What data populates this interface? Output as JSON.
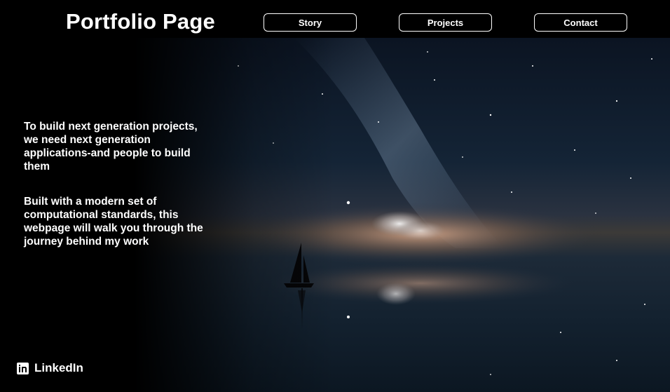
{
  "header": {
    "title": "Portfolio Page",
    "nav": [
      {
        "label": "Story"
      },
      {
        "label": "Projects"
      },
      {
        "label": "Contact"
      }
    ]
  },
  "hero": {
    "paragraphs": [
      "To build next generation projects, we need next generation applications-and people to build them",
      "Built with a modern set of computational standards, this webpage will walk you through the journey behind my work"
    ],
    "background": "night sky with milky way reflected over calm water with a sailboat"
  },
  "social": {
    "linkedin_label": "LinkedIn",
    "icon": "linkedin-icon"
  },
  "colors": {
    "background": "#000000",
    "text": "#ffffff"
  }
}
